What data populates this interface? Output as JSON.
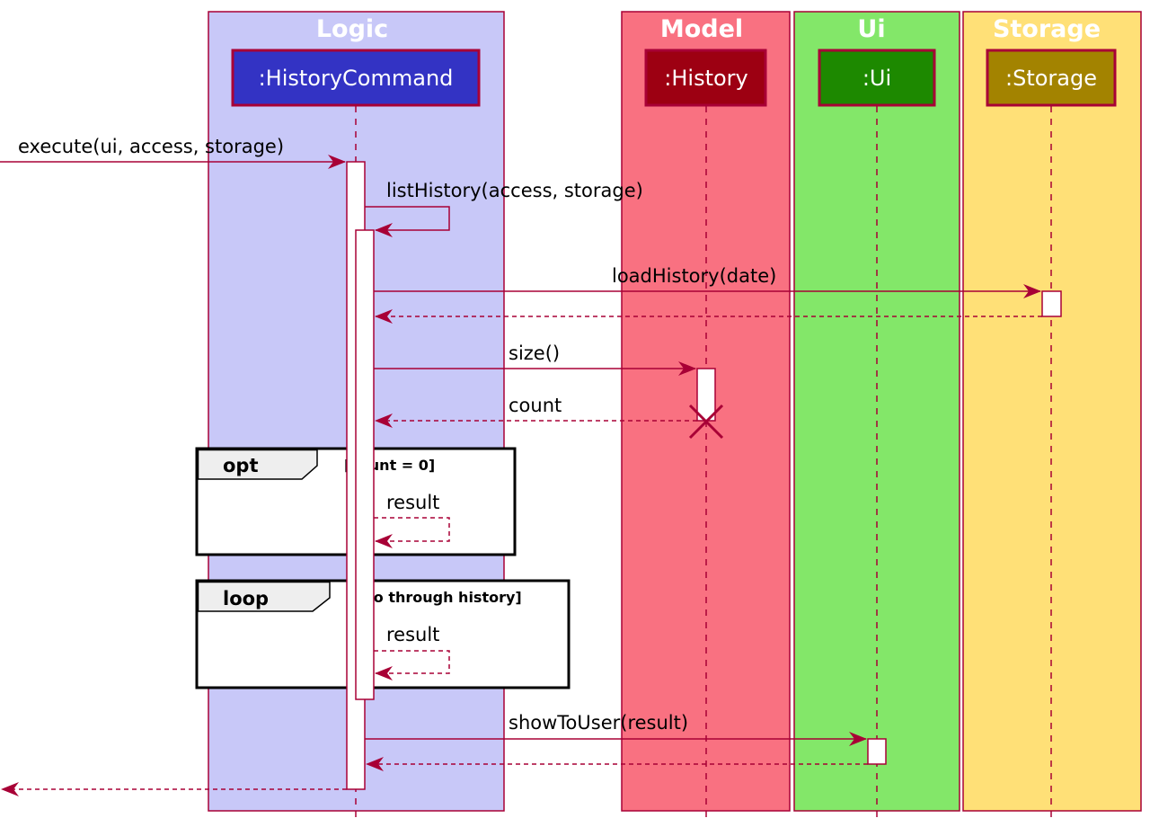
{
  "diagram": {
    "type": "sequence",
    "colors": {
      "line": "#A80036",
      "logic_box": "#C8C8F8",
      "model_box": "#F97181",
      "ui_box": "#83E769",
      "storage_box": "#FFE077",
      "history_command": "#3333C4",
      "history": "#9D0012",
      "ui": "#1D8900",
      "storage": "#A38300"
    },
    "boxes": [
      {
        "title": "Logic"
      },
      {
        "title": "Model"
      },
      {
        "title": "Ui"
      },
      {
        "title": "Storage"
      }
    ],
    "participants": [
      {
        "label": ":HistoryCommand"
      },
      {
        "label": ":History"
      },
      {
        "label": ":Ui"
      },
      {
        "label": ":Storage"
      }
    ],
    "messages": [
      {
        "label": "execute(ui, access, storage)",
        "from": "external",
        "to": ":HistoryCommand",
        "kind": "call"
      },
      {
        "label": "listHistory(access, storage)",
        "from": ":HistoryCommand",
        "to": ":HistoryCommand",
        "kind": "self-call"
      },
      {
        "label": "loadHistory(date)",
        "from": ":HistoryCommand",
        "to": ":Storage",
        "kind": "call"
      },
      {
        "label": "",
        "from": ":Storage",
        "to": ":HistoryCommand",
        "kind": "return"
      },
      {
        "label": "size()",
        "from": ":HistoryCommand",
        "to": ":History",
        "kind": "call"
      },
      {
        "label": "count",
        "from": ":History",
        "to": ":HistoryCommand",
        "kind": "return",
        "destroy": true
      },
      {
        "label": "result",
        "from": ":HistoryCommand",
        "to": ":HistoryCommand",
        "kind": "self-return",
        "frame": "opt"
      },
      {
        "label": "result",
        "from": ":HistoryCommand",
        "to": ":HistoryCommand",
        "kind": "self-return",
        "frame": "loop"
      },
      {
        "label": "showToUser(result)",
        "from": ":HistoryCommand",
        "to": ":Ui",
        "kind": "call"
      },
      {
        "label": "",
        "from": ":Ui",
        "to": ":HistoryCommand",
        "kind": "return"
      },
      {
        "label": "",
        "from": ":HistoryCommand",
        "to": "external",
        "kind": "return"
      }
    ],
    "frames": [
      {
        "tag": "opt",
        "guard": "[count = 0]"
      },
      {
        "tag": "loop",
        "guard": "[go through history]"
      }
    ]
  }
}
